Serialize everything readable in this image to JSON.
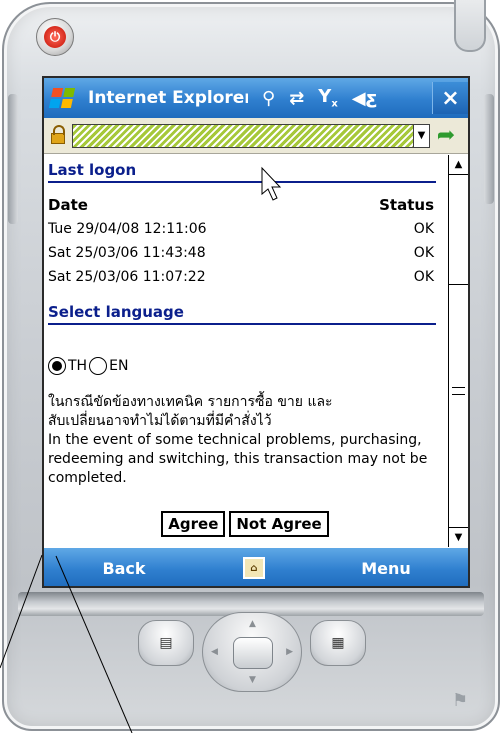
{
  "device": {
    "power_icon": "power-icon",
    "start_icon": "windows-flag-icon"
  },
  "titlebar": {
    "app_title": "Internet Explorer",
    "icons": [
      "connectivity-icon",
      "sync-icon",
      "signal-off-icon",
      "volume-icon"
    ],
    "close_label": "×"
  },
  "address": {
    "lock_icon": "lock-icon",
    "go_icon": "go-arrow-icon"
  },
  "last_logon": {
    "title": "Last logon",
    "col_date": "Date",
    "col_status": "Status",
    "rows": [
      {
        "date": "Tue 29/04/08 12:11:06",
        "status": "OK"
      },
      {
        "date": "Sat 25/03/06 11:43:48",
        "status": "OK"
      },
      {
        "date": "Sat 25/03/06 11:07:22",
        "status": "OK"
      }
    ]
  },
  "language": {
    "title": "Select language",
    "options": [
      {
        "label": "TH",
        "selected": true
      },
      {
        "label": "EN",
        "selected": false
      }
    ]
  },
  "notice": {
    "thai_line1": "ในกรณีขัดข้องทางเทคนิค รายการซื้อ ขาย และ",
    "thai_line2": "สับเปลี่ยนอาจทำไม่ได้ตามที่มีคำสั่งไว้",
    "english": "In the event of some technical problems, purchasing, redeeming and switching, this transaction may not be completed."
  },
  "actions": {
    "agree": "Agree",
    "not_agree": "Not Agree"
  },
  "softkeys": {
    "left": "Back",
    "center_icon": "input-panel-icon",
    "right": "Menu"
  },
  "colors": {
    "titlebar_blue": "#2f7fcf",
    "section_blue": "#0b1f8c",
    "address_green": "#a6c83a"
  }
}
